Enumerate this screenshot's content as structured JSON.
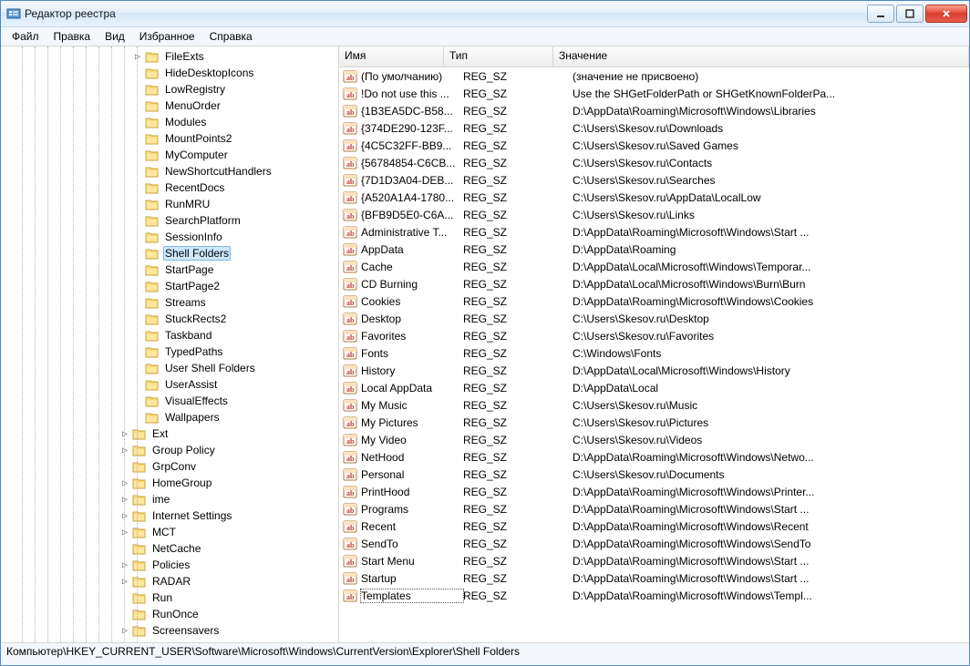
{
  "window": {
    "title": "Редактор реестра"
  },
  "menu": [
    "Файл",
    "Правка",
    "Вид",
    "Избранное",
    "Справка"
  ],
  "tree": [
    {
      "depth": 10,
      "exp": "▷",
      "label": "FileExts"
    },
    {
      "depth": 10,
      "exp": "",
      "label": "HideDesktopIcons"
    },
    {
      "depth": 10,
      "exp": "",
      "label": "LowRegistry"
    },
    {
      "depth": 10,
      "exp": "",
      "label": "MenuOrder"
    },
    {
      "depth": 10,
      "exp": "",
      "label": "Modules"
    },
    {
      "depth": 10,
      "exp": "",
      "label": "MountPoints2"
    },
    {
      "depth": 10,
      "exp": "",
      "label": "MyComputer"
    },
    {
      "depth": 10,
      "exp": "",
      "label": "NewShortcutHandlers"
    },
    {
      "depth": 10,
      "exp": "",
      "label": "RecentDocs"
    },
    {
      "depth": 10,
      "exp": "",
      "label": "RunMRU"
    },
    {
      "depth": 10,
      "exp": "",
      "label": "SearchPlatform"
    },
    {
      "depth": 10,
      "exp": "",
      "label": "SessionInfo"
    },
    {
      "depth": 10,
      "exp": "",
      "label": "Shell Folders",
      "selected": true
    },
    {
      "depth": 10,
      "exp": "",
      "label": "StartPage"
    },
    {
      "depth": 10,
      "exp": "",
      "label": "StartPage2"
    },
    {
      "depth": 10,
      "exp": "",
      "label": "Streams"
    },
    {
      "depth": 10,
      "exp": "",
      "label": "StuckRects2"
    },
    {
      "depth": 10,
      "exp": "",
      "label": "Taskband"
    },
    {
      "depth": 10,
      "exp": "",
      "label": "TypedPaths"
    },
    {
      "depth": 10,
      "exp": "",
      "label": "User Shell Folders"
    },
    {
      "depth": 10,
      "exp": "",
      "label": "UserAssist"
    },
    {
      "depth": 10,
      "exp": "",
      "label": "VisualEffects"
    },
    {
      "depth": 10,
      "exp": "",
      "label": "Wallpapers"
    },
    {
      "depth": 9,
      "exp": "▷",
      "label": "Ext"
    },
    {
      "depth": 9,
      "exp": "▷",
      "label": "Group Policy"
    },
    {
      "depth": 9,
      "exp": "",
      "label": "GrpConv"
    },
    {
      "depth": 9,
      "exp": "▷",
      "label": "HomeGroup"
    },
    {
      "depth": 9,
      "exp": "▷",
      "label": "ime"
    },
    {
      "depth": 9,
      "exp": "▷",
      "label": "Internet Settings"
    },
    {
      "depth": 9,
      "exp": "▷",
      "label": "MCT"
    },
    {
      "depth": 9,
      "exp": "",
      "label": "NetCache"
    },
    {
      "depth": 9,
      "exp": "▷",
      "label": "Policies"
    },
    {
      "depth": 9,
      "exp": "▷",
      "label": "RADAR"
    },
    {
      "depth": 9,
      "exp": "",
      "label": "Run"
    },
    {
      "depth": 9,
      "exp": "",
      "label": "RunOnce"
    },
    {
      "depth": 9,
      "exp": "▷",
      "label": "Screensavers"
    }
  ],
  "columns": {
    "name": "Имя",
    "type": "Тип",
    "value": "Значение"
  },
  "values": [
    {
      "name": "(По умолчанию)",
      "type": "REG_SZ",
      "value": "(значение не присвоено)"
    },
    {
      "name": "!Do not use this ...",
      "type": "REG_SZ",
      "value": "Use the SHGetFolderPath or SHGetKnownFolderPa..."
    },
    {
      "name": "{1B3EA5DC-B58...",
      "type": "REG_SZ",
      "value": "D:\\AppData\\Roaming\\Microsoft\\Windows\\Libraries"
    },
    {
      "name": "{374DE290-123F...",
      "type": "REG_SZ",
      "value": "C:\\Users\\Skesov.ru\\Downloads"
    },
    {
      "name": "{4C5C32FF-BB9...",
      "type": "REG_SZ",
      "value": "C:\\Users\\Skesov.ru\\Saved Games"
    },
    {
      "name": "{56784854-C6CB...",
      "type": "REG_SZ",
      "value": "C:\\Users\\Skesov.ru\\Contacts"
    },
    {
      "name": "{7D1D3A04-DEB...",
      "type": "REG_SZ",
      "value": "C:\\Users\\Skesov.ru\\Searches"
    },
    {
      "name": "{A520A1A4-1780...",
      "type": "REG_SZ",
      "value": "C:\\Users\\Skesov.ru\\AppData\\LocalLow"
    },
    {
      "name": "{BFB9D5E0-C6A...",
      "type": "REG_SZ",
      "value": "C:\\Users\\Skesov.ru\\Links"
    },
    {
      "name": "Administrative T...",
      "type": "REG_SZ",
      "value": "D:\\AppData\\Roaming\\Microsoft\\Windows\\Start ..."
    },
    {
      "name": "AppData",
      "type": "REG_SZ",
      "value": "D:\\AppData\\Roaming"
    },
    {
      "name": "Cache",
      "type": "REG_SZ",
      "value": "D:\\AppData\\Local\\Microsoft\\Windows\\Temporar..."
    },
    {
      "name": "CD Burning",
      "type": "REG_SZ",
      "value": "D:\\AppData\\Local\\Microsoft\\Windows\\Burn\\Burn"
    },
    {
      "name": "Cookies",
      "type": "REG_SZ",
      "value": "D:\\AppData\\Roaming\\Microsoft\\Windows\\Cookies"
    },
    {
      "name": "Desktop",
      "type": "REG_SZ",
      "value": "C:\\Users\\Skesov.ru\\Desktop"
    },
    {
      "name": "Favorites",
      "type": "REG_SZ",
      "value": "C:\\Users\\Skesov.ru\\Favorites"
    },
    {
      "name": "Fonts",
      "type": "REG_SZ",
      "value": "C:\\Windows\\Fonts"
    },
    {
      "name": "History",
      "type": "REG_SZ",
      "value": "D:\\AppData\\Local\\Microsoft\\Windows\\History"
    },
    {
      "name": "Local AppData",
      "type": "REG_SZ",
      "value": "D:\\AppData\\Local"
    },
    {
      "name": "My Music",
      "type": "REG_SZ",
      "value": "C:\\Users\\Skesov.ru\\Music"
    },
    {
      "name": "My Pictures",
      "type": "REG_SZ",
      "value": "C:\\Users\\Skesov.ru\\Pictures"
    },
    {
      "name": "My Video",
      "type": "REG_SZ",
      "value": "C:\\Users\\Skesov.ru\\Videos"
    },
    {
      "name": "NetHood",
      "type": "REG_SZ",
      "value": "D:\\AppData\\Roaming\\Microsoft\\Windows\\Netwo..."
    },
    {
      "name": "Personal",
      "type": "REG_SZ",
      "value": "C:\\Users\\Skesov.ru\\Documents"
    },
    {
      "name": "PrintHood",
      "type": "REG_SZ",
      "value": "D:\\AppData\\Roaming\\Microsoft\\Windows\\Printer..."
    },
    {
      "name": "Programs",
      "type": "REG_SZ",
      "value": "D:\\AppData\\Roaming\\Microsoft\\Windows\\Start ..."
    },
    {
      "name": "Recent",
      "type": "REG_SZ",
      "value": "D:\\AppData\\Roaming\\Microsoft\\Windows\\Recent"
    },
    {
      "name": "SendTo",
      "type": "REG_SZ",
      "value": "D:\\AppData\\Roaming\\Microsoft\\Windows\\SendTo"
    },
    {
      "name": "Start Menu",
      "type": "REG_SZ",
      "value": "D:\\AppData\\Roaming\\Microsoft\\Windows\\Start ..."
    },
    {
      "name": "Startup",
      "type": "REG_SZ",
      "value": "D:\\AppData\\Roaming\\Microsoft\\Windows\\Start ..."
    },
    {
      "name": "Templates",
      "type": "REG_SZ",
      "value": "D:\\AppData\\Roaming\\Microsoft\\Windows\\Templ...",
      "selected": true
    }
  ],
  "status": "Компьютер\\HKEY_CURRENT_USER\\Software\\Microsoft\\Windows\\CurrentVersion\\Explorer\\Shell Folders"
}
